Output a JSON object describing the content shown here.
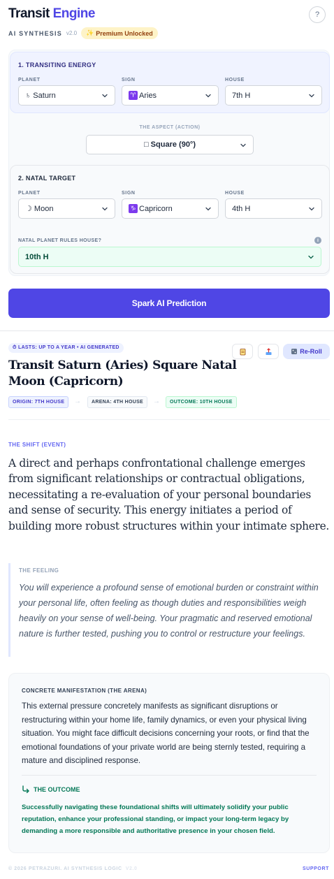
{
  "header": {
    "brand_main": "Transit",
    "brand_accent": "Engine",
    "subtitle": "AI SYNTHESIS",
    "version": "v2.0",
    "premium_badge": "Premium Unlocked",
    "premium_icon": "sparkles-icon",
    "help_label": "?"
  },
  "form": {
    "transiting": {
      "title": "1. TRANSITING ENERGY",
      "planet_label": "PLANET",
      "planet_value": "♄ Saturn",
      "sign_label": "SIGN",
      "sign_glyph": "♈",
      "sign_value": "Aries",
      "house_label": "HOUSE",
      "house_value": "7th H"
    },
    "aspect": {
      "label": "THE ASPECT (ACTION)",
      "value": "□ Square (90°)"
    },
    "natal": {
      "title": "2. NATAL TARGET",
      "planet_label": "PLANET",
      "planet_value": "☽ Moon",
      "sign_label": "SIGN",
      "sign_glyph": "♑",
      "sign_value": "Capricorn",
      "house_label": "HOUSE",
      "house_value": "4th H",
      "rules_label": "NATAL PLANET RULES HOUSE?",
      "rules_value": "10th H"
    },
    "submit_label": "Spark AI Prediction"
  },
  "result": {
    "duration_badge": "⏱ LASTS: UP TO A YEAR • AI GENERATED",
    "reroll_label": "Re-Roll",
    "title": "Transit Saturn (Aries) Square Natal Moon (Capricorn)",
    "chips": {
      "origin": "ORIGIN: 7TH HOUSE",
      "arena": "ARENA: 4TH HOUSE",
      "outcome": "OUTCOME: 10TH HOUSE"
    },
    "shift_label": "THE SHIFT (EVENT)",
    "shift_text": "A direct and perhaps confrontational challenge emerges from significant relationships or contractual obligations, necessitating a re-evaluation of your personal boundaries and sense of security. This energy initiates a period of building more robust structures within your intimate sphere.",
    "feeling_label": "THE FEELING",
    "feeling_text": "You will experience a profound sense of emotional burden or constraint within your personal life, often feeling as though duties and responsibilities weigh heavily on your sense of well-being. Your pragmatic and reserved emotional nature is further tested, pushing you to control or restructure your feelings.",
    "manifest_label": "CONCRETE MANIFESTATION (THE ARENA)",
    "manifest_text": "This external pressure concretely manifests as significant disruptions or restructuring within your home life, family dynamics, or even your physical living situation. You might face difficult decisions concerning your roots, or find that the emotional foundations of your private world are being sternly tested, requiring a mature and disciplined response.",
    "outcome_label": "THE OUTCOME",
    "outcome_text": "Successfully navigating these foundational shifts will ultimately solidify your public reputation, enhance your professional standing, or impact your long-term legacy by demanding a more responsible and authoritative presence in your chosen field."
  },
  "footer": {
    "copyright": "© 2026 PETRAZURI. AI SYNTHESIS LOGIC",
    "version": "V2.0",
    "support": "SUPPORT"
  },
  "colors": {
    "accent": "#4f46e5",
    "outcome_green": "#047857",
    "premium_bg": "#fef3c7"
  }
}
